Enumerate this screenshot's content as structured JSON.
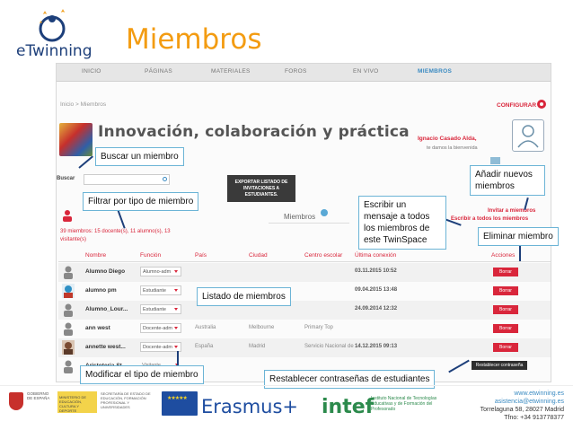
{
  "slide": {
    "logo_text": "eTwinning",
    "title": "Miembros"
  },
  "navbar": {
    "items": [
      "INICIO",
      "PÁGINAS",
      "MATERIALES",
      "FOROS",
      "EN VIVO",
      "MIEMBROS"
    ],
    "active": "MIEMBROS"
  },
  "page": {
    "breadcrumb": "Inicio  >  Miembros",
    "configure": "CONFIGURAR",
    "space_title": "Innovación, colaboración y práctica",
    "user_name": "Ignacio Casado Alda,",
    "welcome": "te damos la bienvenida",
    "search_label": "Buscar",
    "search_placeholder": "",
    "export_button": "EXPORTAR LISTADO DE INVITACIONES A ESTUDIANTES.",
    "members_heading": "Miembros",
    "counts": "39 miembros: 15 docente(s), 11 alumno(s), 13 visitante(s)",
    "invite_link": "Invitar a miembros",
    "write_all_link": "Escribir a todos los miembros",
    "reset_button": "Restablecer contraseña"
  },
  "table": {
    "headers": [
      "Nombre",
      "Función",
      "País",
      "Ciudad",
      "Centro escolar",
      "Última conexión",
      "Acciones"
    ],
    "rows": [
      {
        "name": "Alumno Diego",
        "role": "Alumno-adm",
        "country": "",
        "city": "",
        "school": "",
        "last": "03.11.2015 10:52",
        "action": "Borrar"
      },
      {
        "name": "alumno pm",
        "role": "Estudiante",
        "country": "",
        "city": "",
        "school": "",
        "last": "09.04.2015 13:48",
        "action": "Borrar"
      },
      {
        "name": "Alumno_Lour...",
        "role": "Estudiante",
        "country": "",
        "city": "",
        "school": "",
        "last": "24.09.2014 12:32",
        "action": "Borrar"
      },
      {
        "name": "ann west",
        "role": "Docente-adm",
        "country": "Australia",
        "city": "Melbourne",
        "school": "Primary Top",
        "last": "",
        "action": "Borrar"
      },
      {
        "name": "annette west...",
        "role": "Docente-adm",
        "country": "España",
        "city": "Madrid",
        "school": "Servicio Nacional de ...",
        "last": "14.12.2015 09:13",
        "action": "Borrar"
      },
      {
        "name": "Aristoteria St...",
        "role": "Visitante",
        "country": "",
        "city": "",
        "school": "",
        "last": "",
        "action": "Borrar"
      }
    ]
  },
  "callouts": {
    "search": "Buscar un miembro",
    "filter": "Filtrar por tipo de miembro",
    "write": "Escribir un mensaje a todos los miembros de este TwinSpace",
    "add": "Añadir nuevos miembros",
    "delete": "Eliminar miembro",
    "list": "Listado de miembros",
    "modify": "Modificar el tipo de miembro",
    "reset": "Restablecer contraseñas de estudiantes"
  },
  "footer": {
    "gov_text": "GOBIERNO DE ESPAÑA",
    "ministry_text": "MINISTERIO DE EDUCACIÓN, CULTURA Y DEPORTE",
    "agency_text": "SECRETARÍA DE ESTADO DE EDUCACIÓN, FORMACIÓN PROFESIONAL Y UNIVERSIDADES",
    "erasmus": "Erasmus+",
    "intef": "intef",
    "intef_text": "Instituto Nacional de Tecnologías Educativas y de Formación del Profesorado",
    "contact": [
      "www.etwinning.es",
      "asistencia@etwinning.es",
      "Torrelaguna 58, 28027 Madrid",
      "Tfno: +34 913778377"
    ]
  },
  "colors": {
    "accent_orange": "#f39c12",
    "brand_red": "#d9263b",
    "callout_border": "#6cb4d6",
    "link_blue": "#3b8bc2"
  }
}
